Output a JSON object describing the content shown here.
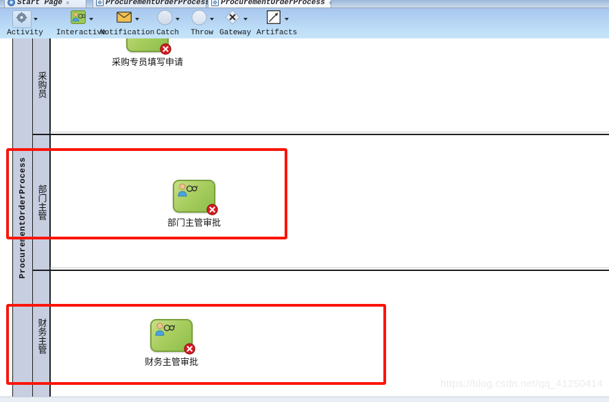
{
  "window": {
    "tabs": [
      {
        "label": "Start Page",
        "icon": "start-page-icon",
        "active": false,
        "closable": true
      },
      {
        "label": "ProcurementOrderProcess",
        "icon": "diagram-file-icon",
        "active": false,
        "closable": true
      },
      {
        "label": "ProcurementOrderProcess",
        "icon": "diagram-file-icon",
        "active": true,
        "closable": true
      }
    ]
  },
  "toolbar": {
    "groups": [
      {
        "label": "Activity",
        "icon": "gear-icon",
        "has_dropdown": true
      },
      {
        "label": "Interactive",
        "icon": "user-task-icon",
        "has_dropdown": true
      },
      {
        "label": "Notification",
        "icon": "envelope-icon",
        "has_dropdown": true
      },
      {
        "label": "Catch",
        "icon": "catch-event-circle-icon",
        "has_dropdown": true
      },
      {
        "label": "Throw",
        "icon": "throw-event-circle-icon",
        "has_dropdown": true
      },
      {
        "label": "Gateway",
        "icon": "gateway-diamond-icon",
        "has_dropdown": true
      },
      {
        "label": "Artifacts",
        "icon": "artifacts-arrow-icon",
        "has_dropdown": true
      }
    ]
  },
  "diagram": {
    "pool_name": "ProcurementOrderProcess",
    "lanes": [
      {
        "name": "采购员",
        "tasks": [
          {
            "label": "采购专员填写申请",
            "icon": "user-task-icon",
            "badge": "error-badge"
          }
        ]
      },
      {
        "name": "部门主管",
        "tasks": [
          {
            "label": "部门主管审批",
            "icon": "user-task-icon",
            "badge": "error-badge"
          }
        ]
      },
      {
        "name": "财务主管",
        "tasks": [
          {
            "label": "财务主管审批",
            "icon": "user-task-icon",
            "badge": "error-badge"
          }
        ]
      }
    ],
    "annotations": [
      {
        "name": "department-manager-highlight",
        "color": "#fb1409"
      },
      {
        "name": "finance-manager-highlight",
        "color": "#fb1409"
      }
    ]
  },
  "watermark": {
    "text": "https://blog.csdn.net/qq_41250414"
  },
  "colors": {
    "toolbar_top": "#a8c6ef",
    "toolbar_bottom": "#c6e4f9",
    "lane_header": "#c7cee0",
    "task_green": "#a9ce60",
    "annotation_red": "#fb1409"
  }
}
